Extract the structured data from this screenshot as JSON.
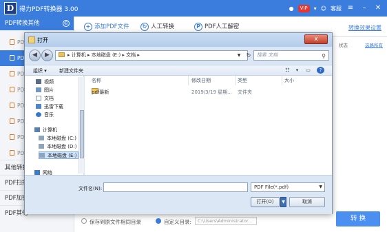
{
  "app": {
    "logo_letter": "D",
    "title": "得力PDF转换器 3.00",
    "vip_label": "VIP",
    "customer_service": "客服"
  },
  "sidebar": {
    "header": "PDF转换其他",
    "header_icon": "©",
    "sub_items": [
      {
        "label": "PDF"
      },
      {
        "label": "PDF"
      },
      {
        "label": "PDF"
      },
      {
        "label": "PDF"
      },
      {
        "label": "PDF"
      },
      {
        "label": "PDF"
      },
      {
        "label": "PDF"
      },
      {
        "label": "PDF"
      }
    ],
    "categories": [
      "其他转换",
      "PDF扫描",
      "PDF加密",
      "PDF其他"
    ]
  },
  "tabs": {
    "add_pdf": "添加PDF文件",
    "manual_convert": "人工转换",
    "manual_decrypt": "PDF人工解密",
    "effect_link": "转换效果设置"
  },
  "right_columns": {
    "status": "状态",
    "op": "选路所有"
  },
  "bottom": {
    "option1": "保存到原文件相同目录",
    "option2": "自定义目录:",
    "path": "C:\\Users\\Administrator...",
    "convert": "转 换"
  },
  "dialog": {
    "title": "打开",
    "close": "x",
    "address": [
      "计算机",
      "本地磁盘 (E:)",
      "文档"
    ],
    "search_placeholder": "搜索 文档",
    "toolbar": {
      "organize": "组织 ▾",
      "new_folder": "新建文件夹"
    },
    "nav_items": [
      {
        "label": "视频",
        "icon": "video-icon"
      },
      {
        "label": "图片",
        "icon": "picture-icon"
      },
      {
        "label": "文档",
        "icon": "document-icon"
      },
      {
        "label": "迅雷下载",
        "icon": "download-icon"
      },
      {
        "label": "音乐",
        "icon": "music-icon"
      },
      {
        "label": "计算机",
        "icon": "computer-icon"
      },
      {
        "label": "本地磁盘 (C:)",
        "icon": "drive-icon"
      },
      {
        "label": "本地磁盘 (D:)",
        "icon": "drive-icon"
      },
      {
        "label": "本地磁盘 (E:)",
        "icon": "drive-icon"
      },
      {
        "label": "网络",
        "icon": "network-icon"
      }
    ],
    "columns": {
      "name": "名称",
      "modified": "修改日期",
      "type": "类型",
      "size": "大小"
    },
    "files": [
      {
        "name": "pdf最新",
        "modified": "2019/3/19 星期...",
        "type": "文件夹",
        "size": ""
      }
    ],
    "filename_label": "文件名(N):",
    "filename_value": "",
    "filetype": "PDF File(*.pdf)",
    "open": "打开(O)",
    "cancel": "取消"
  }
}
